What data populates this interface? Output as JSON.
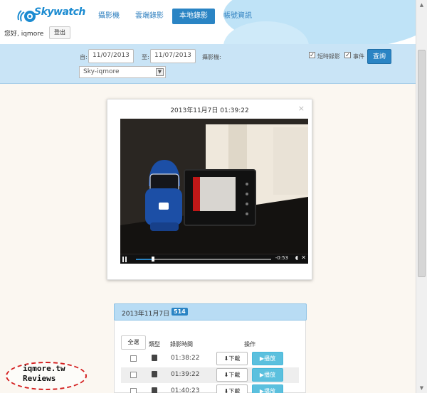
{
  "brand": {
    "name": "Skywatch"
  },
  "nav": [
    {
      "label": "攝影機"
    },
    {
      "label": "雲端錄影"
    },
    {
      "label": "本地錄影"
    },
    {
      "label": "帳號資訊"
    }
  ],
  "user": {
    "greeting": "您好, iqmore",
    "logout_label": "登出"
  },
  "filter": {
    "from_label": "自:",
    "from_value": "11/07/2013",
    "to_label": "至:",
    "to_value": "11/07/2013",
    "camera_label": "攝影機:",
    "camera_value": "Sky-iqmore",
    "timed_label": "短時錄影",
    "event_label": "事件",
    "search_label": "查詢"
  },
  "player": {
    "title": "2013年11月7日 01:39:22",
    "close": "×",
    "time_remaining": "-0:53"
  },
  "records": {
    "date": "2013年11月7日",
    "count": "514",
    "select_all_label": "全選",
    "col_type": "類型",
    "col_time": "錄影時間",
    "col_action": "操作",
    "download_label": "⬇下載",
    "play_label": "▶播放",
    "rows": [
      {
        "time": "01:38:22"
      },
      {
        "time": "01:39:22"
      },
      {
        "time": "01:40:23"
      }
    ]
  },
  "watermark": {
    "line1": "iqmore.tw",
    "line2": "Reviews"
  },
  "colors": {
    "accent": "#2a84c4",
    "play": "#5bc0de",
    "panel": "#c9e4f6"
  }
}
